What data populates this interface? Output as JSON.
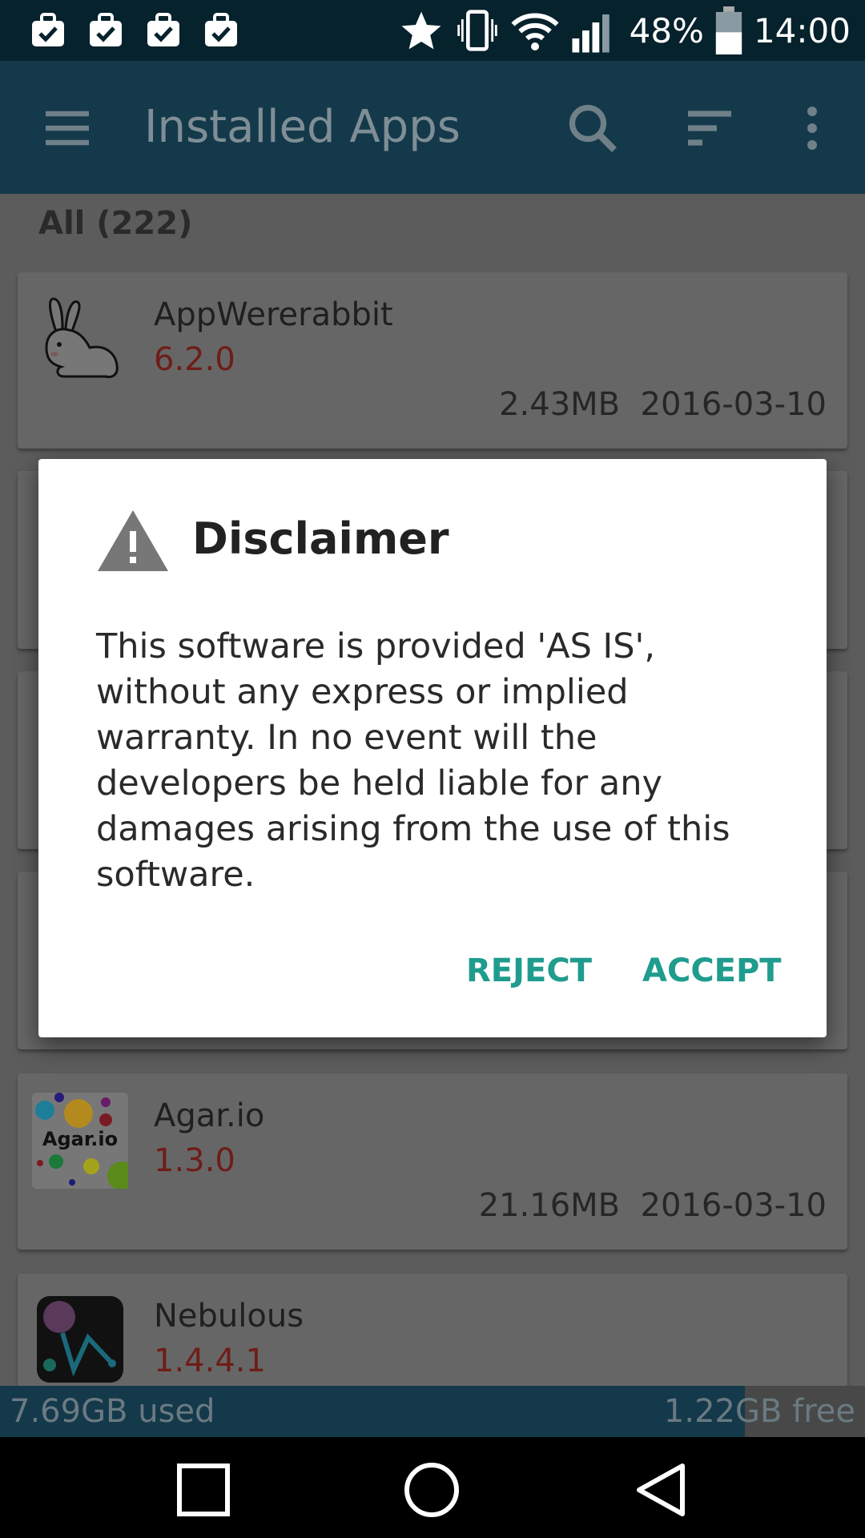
{
  "status_bar": {
    "battery": "48%",
    "time": "14:00",
    "notification_icons": [
      "briefcase-check-icon",
      "briefcase-check-icon",
      "briefcase-check-icon",
      "briefcase-check-icon"
    ],
    "status_icons": [
      "star-icon",
      "vibrate-icon",
      "wifi-icon",
      "signal-icon",
      "battery-icon"
    ]
  },
  "app_bar": {
    "title": "Installed Apps",
    "icons": [
      "menu-icon",
      "search-icon",
      "sort-icon",
      "more-vert-icon"
    ]
  },
  "list": {
    "header": "All (222)",
    "apps": [
      {
        "name": "AppWererabbit",
        "version": "6.2.0",
        "size": "2.43MB",
        "date": "2016-03-10",
        "icon": "rabbit-icon"
      },
      {
        "name": "Agar.io",
        "version": "1.3.0",
        "size": "21.16MB",
        "date": "2016-03-10",
        "icon": "agar-io-icon",
        "icon_label": "Agar.io"
      },
      {
        "name": "Nebulous",
        "version": "1.4.4.1",
        "icon": "nebulous-icon"
      }
    ]
  },
  "storage": {
    "used": "7.69GB used",
    "free": "1.22GB free"
  },
  "dialog": {
    "title": "Disclaimer",
    "icon": "warning-icon",
    "body": "This software is provided 'AS IS', without any express or implied warranty. In no event will the developers be held liable for any damages arising from the use of this software.",
    "reject_label": "REJECT",
    "accept_label": "ACCEPT"
  },
  "nav_bar": {
    "icons": [
      "recents-icon",
      "home-icon",
      "back-icon"
    ]
  },
  "colors": {
    "app_bar": "#14394a",
    "status_bar": "#06222c",
    "dialog_button": "#1f9c8e",
    "version_text": "#c0392b"
  }
}
